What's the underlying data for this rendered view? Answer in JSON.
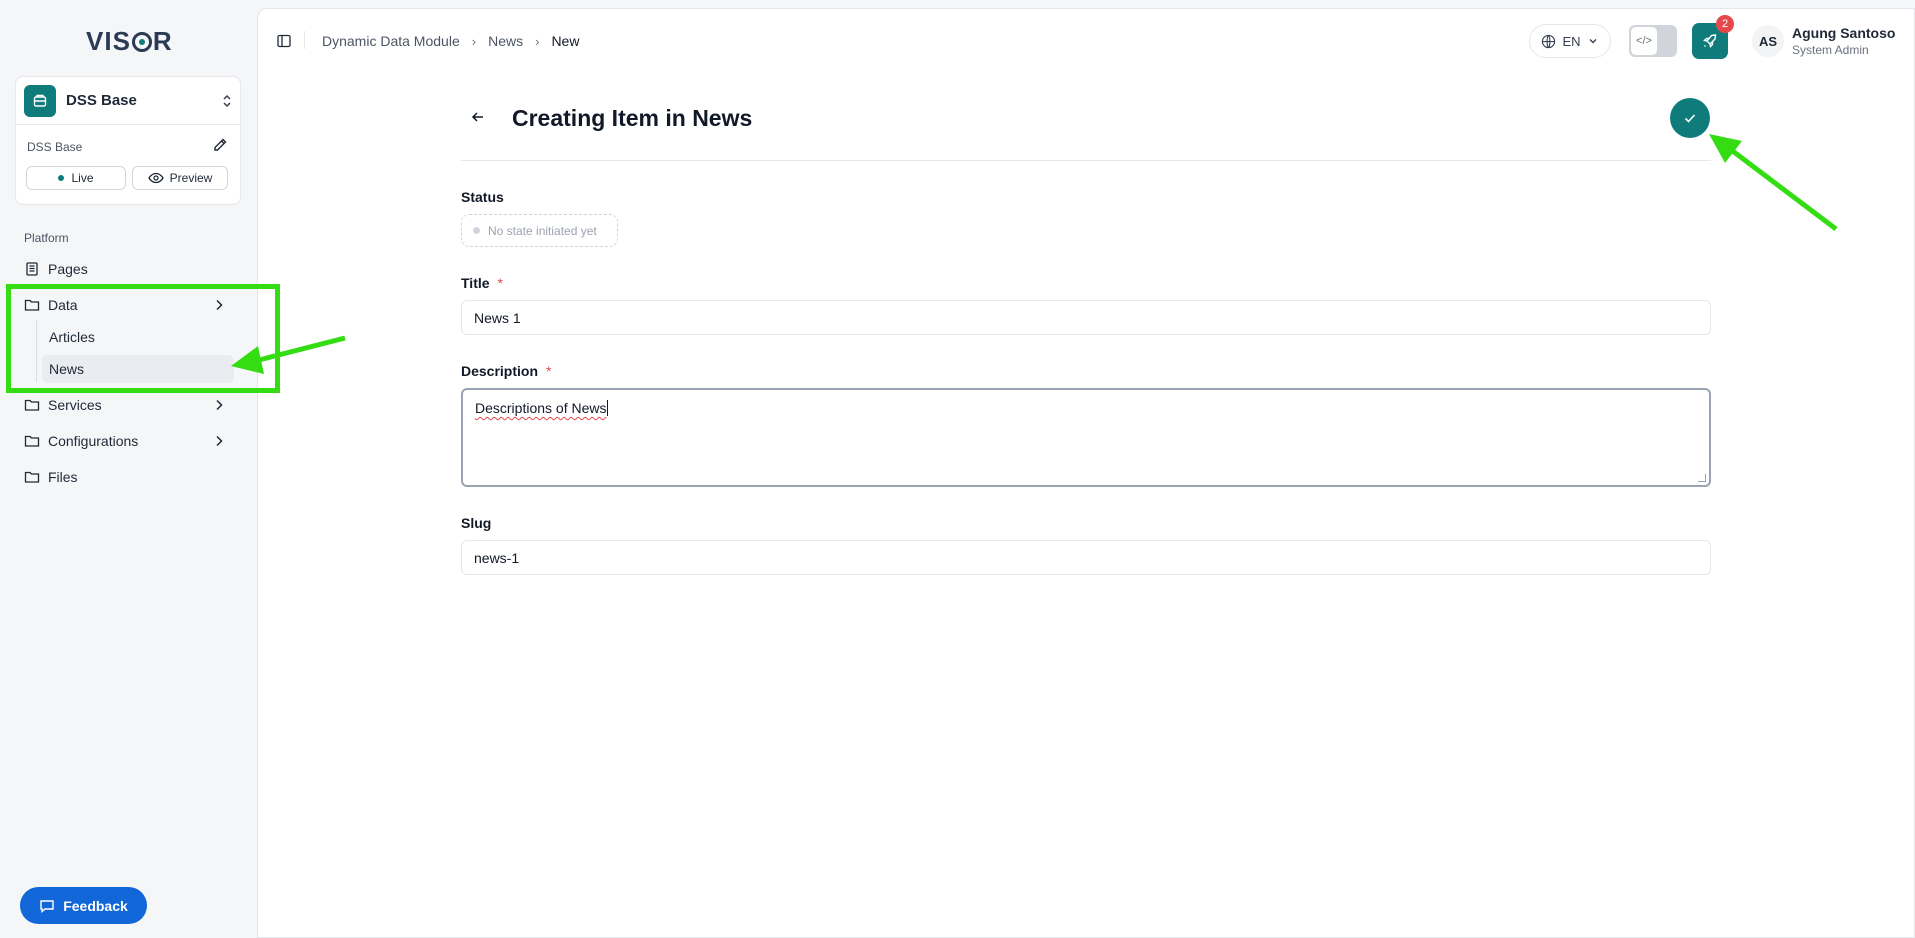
{
  "app": {
    "logo": "VISOR"
  },
  "project": {
    "name": "DSS Base",
    "subtitle": "DSS Base",
    "live_label": "Live",
    "preview_label": "Preview"
  },
  "sidebar": {
    "section": "Platform",
    "items": [
      {
        "label": "Pages"
      },
      {
        "label": "Data"
      },
      {
        "label": "Services"
      },
      {
        "label": "Configurations"
      },
      {
        "label": "Files"
      }
    ],
    "data_children": [
      {
        "label": "Articles"
      },
      {
        "label": "News"
      }
    ],
    "feedback_label": "Feedback"
  },
  "topbar": {
    "breadcrumbs": [
      "Dynamic Data Module",
      "News",
      "New"
    ],
    "language": "EN",
    "notification_count": "2",
    "user_initials": "AS",
    "user_name": "Agung Santoso",
    "user_role": "System Admin"
  },
  "form": {
    "title": "Creating Item in News",
    "status_label": "Status",
    "status_value": "No state initiated yet",
    "title_label": "Title",
    "title_value": "News 1",
    "description_label": "Description",
    "description_value": "Descriptions of News",
    "slug_label": "Slug",
    "slug_value": "news-1",
    "required_mark": "*"
  },
  "colors": {
    "accent": "#0f7b7b",
    "feedback": "#1167d8",
    "annotation": "#33dd11",
    "required": "#e5484d"
  }
}
